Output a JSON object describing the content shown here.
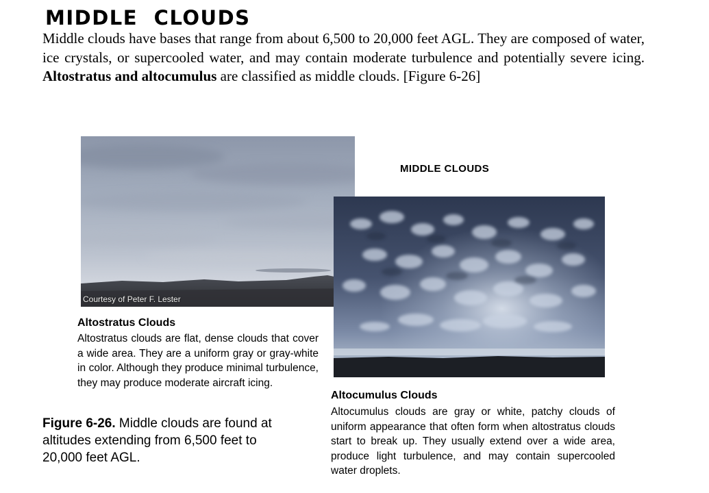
{
  "section": {
    "title": "MIDDLE CLOUDS",
    "intro_part1": "Middle clouds have bases that range from about 6,500 to 20,000 feet AGL. They are composed of water, ice crystals, or supercooled water, and may contain moderate turbulence and potentially severe icing. ",
    "intro_bold": "Altostratus and altocumulus",
    "intro_part2": " are classified as middle clouds. [Figure 6-26]"
  },
  "figure": {
    "label": "MIDDLE CLOUDS",
    "photo_credit": "Courtesy of Peter F. Lester",
    "altostratus": {
      "title": "Altostratus Clouds",
      "body": "Altostratus clouds are flat, dense clouds that cover a wide area.  They are a uniform gray or gray-white in color.  Although they produce minimal turbulence, they may produce moderate aircraft icing."
    },
    "altocumulus": {
      "title": "Altocumulus Clouds",
      "body": "Altocumulus clouds are gray or white, patchy clouds of uniform appearance that often form when altostratus clouds start to break up.  They usually extend over a wide area, produce light turbulence, and may contain supercooled water droplets."
    },
    "caption_number": "Figure 6-26.",
    "caption_text": " Middle clouds are found at altitudes extending from 6,500 feet to 20,000 feet AGL."
  },
  "colors": {
    "text": "#000000",
    "background": "#ffffff",
    "altostratus_sky": "#a9b3c4",
    "altocumulus_sky": "#3e4a64"
  }
}
